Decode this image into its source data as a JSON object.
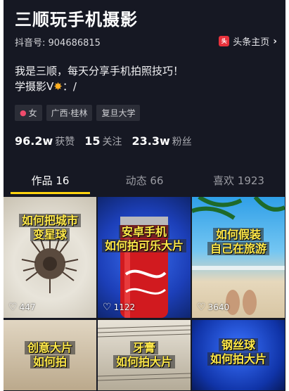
{
  "profile": {
    "name": "三顺玩手机摄影",
    "douyin_id": "抖音号: 904686815",
    "toutiao_link": "头条主页",
    "bio_line1": "我是三顺，每天分享手机拍照技巧！",
    "bio_line2": "学摄影V",
    "bio_line2_tail": "：/",
    "tags": [
      "女",
      "广西·桂林",
      "复旦大学"
    ],
    "stats": [
      {
        "value": "96.2w",
        "label": "获赞"
      },
      {
        "value": "15",
        "label": "关注"
      },
      {
        "value": "23.3w",
        "label": "粉丝"
      }
    ]
  },
  "tabs": [
    {
      "label": "作品 16",
      "active": true
    },
    {
      "label": "动态 66",
      "active": false
    },
    {
      "label": "喜欢 1923",
      "active": false
    }
  ],
  "videos": [
    {
      "caption_line1": "如何把城市",
      "caption_line2": "变星球",
      "likes": "447"
    },
    {
      "caption_line1": "安卓手机",
      "caption_line2": "如何拍可乐大片",
      "likes": "1122"
    },
    {
      "caption_line1": "如何假装",
      "caption_line2": "自己在旅游",
      "likes": "3640"
    },
    {
      "caption_line1": "创意大片",
      "caption_line2": "如何拍",
      "likes": ""
    },
    {
      "caption_line1": "牙膏",
      "caption_line2": "如何拍大片",
      "likes": ""
    },
    {
      "caption_line1": "钢丝球",
      "caption_line2": "如何拍大片",
      "likes": ""
    }
  ],
  "icons": {
    "heart": "heart-outline-icon",
    "toutiao_logo": "toutiao-logo-icon",
    "chevron": "chevron-right-icon",
    "gender": "female-icon"
  },
  "colors": {
    "background": "#161823",
    "tab_indicator": "#fdd30f",
    "caption_text": "#ffe94a"
  }
}
